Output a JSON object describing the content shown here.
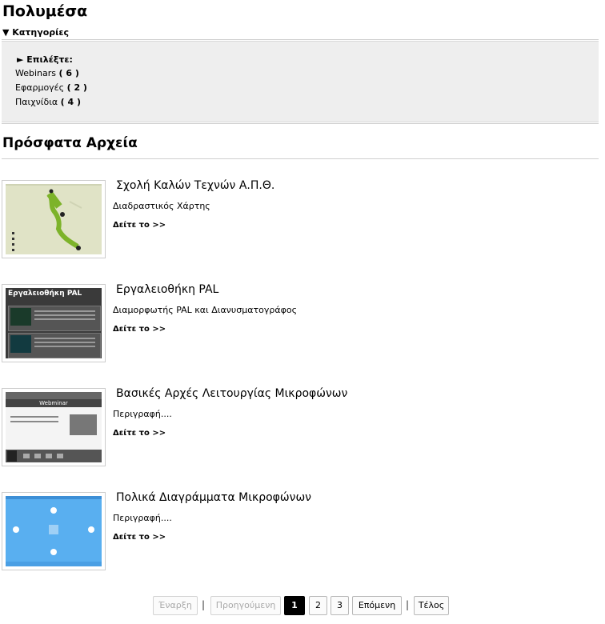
{
  "page": {
    "title": "Πολυμέσα"
  },
  "categories": {
    "toggle_label": "▼ Κατηγορίες",
    "choose_label": "► Επιλέξτε:",
    "items": [
      {
        "name": "Webinars",
        "count": "( 6 )"
      },
      {
        "name": "Εφαρμογές",
        "count": "( 2 )"
      },
      {
        "name": "Παιχνίδια",
        "count": "( 4 )"
      }
    ]
  },
  "recent": {
    "title": "Πρόσφατα Αρχεία",
    "more_label": "Δείτε το >>",
    "files": [
      {
        "title": "Σχολή Καλών Τεχνών Α.Π.Θ.",
        "description": "Διαδραστικός Χάρτης"
      },
      {
        "title": "Εργαλειοθήκη PAL",
        "description": "Διαμορφωτής PAL και Διανυσματογράφος",
        "thumb_heading": "Εργαλειοθήκη PAL"
      },
      {
        "title": "Βασικές Αρχές Λειτουργίας Μικροφώνων",
        "description": "Περιγραφή....",
        "thumb_heading": "Webminar"
      },
      {
        "title": "Πολικά Διαγράμματα Μικροφώνων",
        "description": "Περιγραφή...."
      }
    ]
  },
  "pagination": {
    "first": "Έναρξη",
    "prev": "Προηγούμενη",
    "pages": [
      "1",
      "2",
      "3"
    ],
    "current_page": "1",
    "next": "Επόμενη",
    "last": "Τέλος",
    "separator": "|"
  }
}
